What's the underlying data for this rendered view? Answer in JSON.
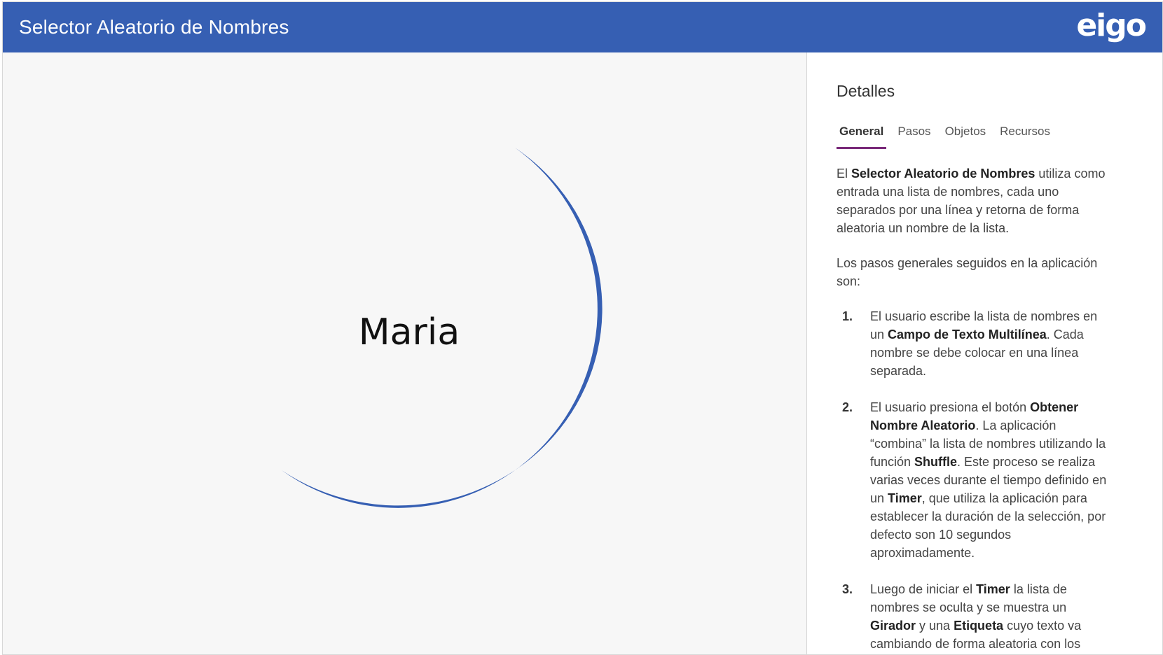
{
  "header": {
    "title": "Selector Aleatorio de Nombres",
    "logo_text": "eigo",
    "background_color": "#365fb3"
  },
  "canvas": {
    "selected_name": "Maria",
    "spinner_color": "#365fb3"
  },
  "panel": {
    "title": "Detalles",
    "tabs": [
      {
        "label": "General",
        "active": true
      },
      {
        "label": "Pasos",
        "active": false
      },
      {
        "label": "Objetos",
        "active": false
      },
      {
        "label": "Recursos",
        "active": false
      }
    ],
    "intro": {
      "t1": "El ",
      "b1": "Selector Aleatorio de Nombres",
      "t2": " utiliza como entrada una lista de nombres, cada uno separados por una línea y retorna de forma aleatoria un nombre de la lista."
    },
    "steps_intro": "Los pasos generales seguidos en la aplicación son:",
    "steps": [
      {
        "num": "1.",
        "t1": "El usuario escribe la lista de nombres en un ",
        "b1": "Campo de Texto Multilínea",
        "t2": ". Cada nombre se debe colocar en una línea separada."
      },
      {
        "num": "2.",
        "t1": "El usuario presiona el botón ",
        "b1": "Obtener Nombre Aleatorio",
        "t2": ". La aplicación “combina” la lista de nombres utilizando la función ",
        "b2": "Shuffle",
        "t3": ". Este proceso se realiza varias veces durante el tiempo definido en un ",
        "b3": "Timer",
        "t4": ", que utiliza la aplicación para establecer la duración de la selección, por defecto son 10 segundos aproximadamente."
      },
      {
        "num": "3.",
        "t1": "Luego de iniciar el ",
        "b1": "Timer",
        "t2": " la lista de nombres se oculta y se muestra un ",
        "b2": "Girador",
        "t3": " y una ",
        "b3": "Etiqueta",
        "t4": " cuyo texto va cambiando de forma aleatoria con los"
      }
    ]
  }
}
